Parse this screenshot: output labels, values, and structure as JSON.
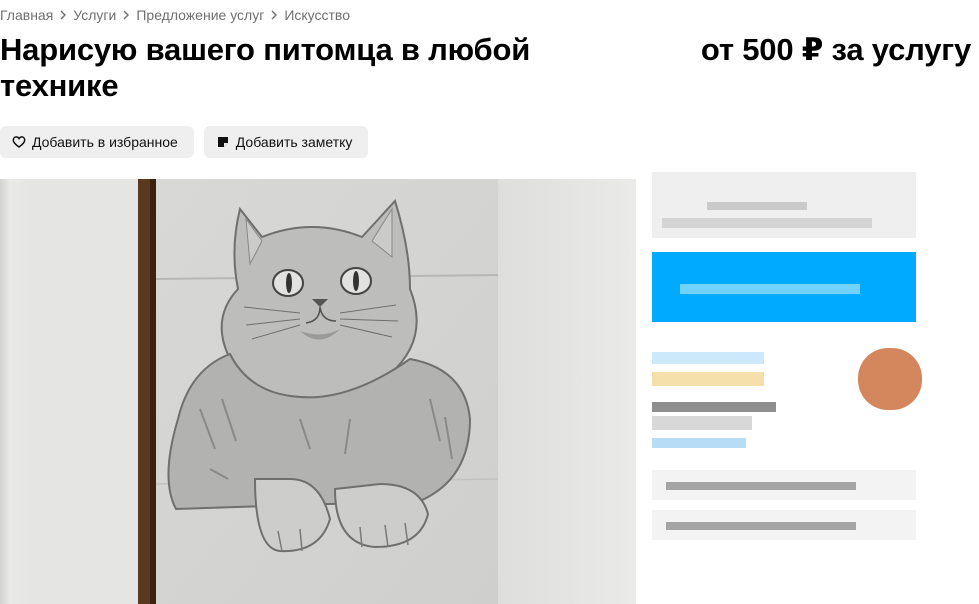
{
  "breadcrumbs": [
    "Главная",
    "Услуги",
    "Предложение услуг",
    "Искусство"
  ],
  "listing": {
    "title": "Нарисую вашего питомца в любой технике",
    "price": "от 500 ₽ за услугу"
  },
  "actions": {
    "favorite_label": "Добавить в избранное",
    "note_label": "Добавить заметку"
  },
  "gallery": {
    "icon": "pencil-drawing-of-cat"
  },
  "colors": {
    "accent": "#00aaff",
    "muted_text": "#6f6f6f",
    "button_bg": "#efefef"
  }
}
